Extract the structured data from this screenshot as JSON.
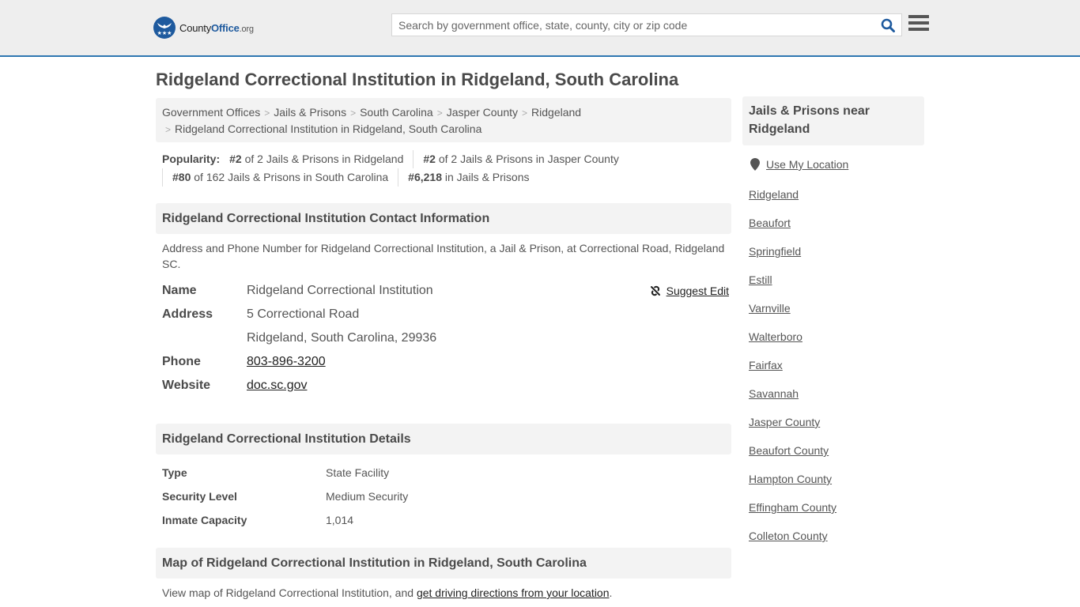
{
  "header": {
    "logo": {
      "brand_a": "County",
      "brand_b": "Office",
      "brand_c": ".org"
    },
    "search": {
      "placeholder": "Search by government office, state, county, city or zip code",
      "value": ""
    },
    "search_icon": "search-icon",
    "menu_icon": "hamburger-menu-icon"
  },
  "page": {
    "title": "Ridgeland Correctional Institution in Ridgeland, South Carolina"
  },
  "breadcrumb": [
    {
      "label": "Government Offices"
    },
    {
      "label": "Jails & Prisons"
    },
    {
      "label": "South Carolina"
    },
    {
      "label": "Jasper County"
    },
    {
      "label": "Ridgeland"
    },
    {
      "label": "Ridgeland Correctional Institution in Ridgeland, South Carolina"
    }
  ],
  "popularity": {
    "label": "Popularity:",
    "items": [
      {
        "rank": "#2",
        "text": " of 2 Jails & Prisons in Ridgeland"
      },
      {
        "rank": "#2",
        "text": " of 2 Jails & Prisons in Jasper County"
      },
      {
        "rank": "#80",
        "text": " of 162 Jails & Prisons in South Carolina"
      },
      {
        "rank": "#6,218",
        "text": " in Jails & Prisons"
      }
    ]
  },
  "contact": {
    "heading": "Ridgeland Correctional Institution Contact Information",
    "description": "Address and Phone Number for Ridgeland Correctional Institution, a Jail & Prison, at Correctional Road, Ridgeland SC.",
    "suggest_edit": "Suggest Edit",
    "rows": {
      "name_label": "Name",
      "name_value": "Ridgeland Correctional Institution",
      "address_label": "Address",
      "address_line1": "5 Correctional Road",
      "address_line2": "Ridgeland, South Carolina, 29936",
      "phone_label": "Phone",
      "phone_value": "803-896-3200",
      "website_label": "Website",
      "website_value": "doc.sc.gov"
    }
  },
  "details": {
    "heading": "Ridgeland Correctional Institution Details",
    "rows": [
      {
        "label": "Type",
        "value": "State Facility"
      },
      {
        "label": "Security Level",
        "value": "Medium Security"
      },
      {
        "label": "Inmate Capacity",
        "value": "1,014"
      }
    ]
  },
  "map": {
    "heading": "Map of Ridgeland Correctional Institution in Ridgeland, South Carolina",
    "text_before": "View map of Ridgeland Correctional Institution, and ",
    "link": "get driving directions from your location",
    "text_after": "."
  },
  "sidebar": {
    "heading": "Jails & Prisons near Ridgeland",
    "use_location": "Use My Location",
    "links": [
      "Ridgeland",
      "Beaufort",
      "Springfield",
      "Estill",
      "Varnville",
      "Walterboro",
      "Fairfax",
      "Savannah",
      "Jasper County",
      "Beaufort County",
      "Hampton County",
      "Effingham County",
      "Colleton County"
    ]
  },
  "colors": {
    "brand_blue": "#1e5a9e",
    "header_border": "#2f77b1",
    "panel_bg": "#f3f3f3"
  }
}
